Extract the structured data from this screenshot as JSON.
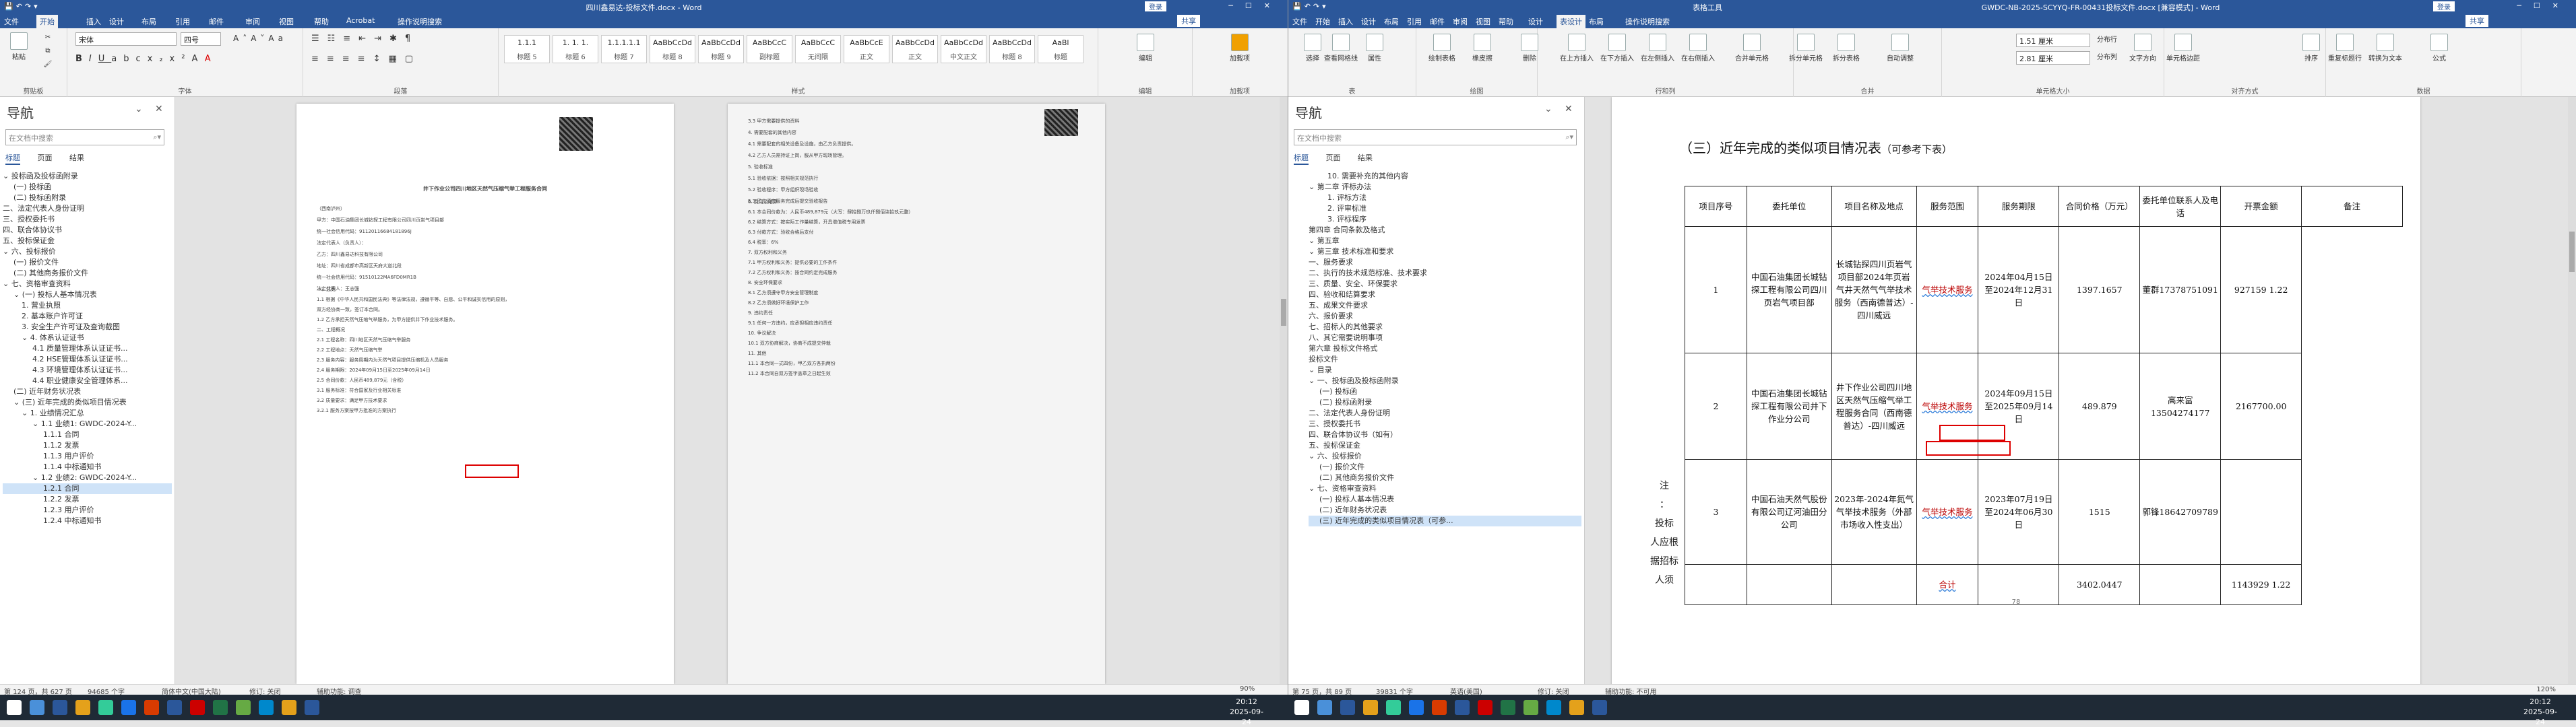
{
  "left_window": {
    "title": "四川鑫易达-投标文件.docx - Word",
    "user_label": "登录",
    "tabs": [
      "文件",
      "开始",
      "插入",
      "设计",
      "布局",
      "引用",
      "邮件",
      "审阅",
      "视图",
      "帮助",
      "Acrobat",
      "操作说明搜索"
    ],
    "share_label": "共享",
    "ribbon": {
      "clipboard": {
        "group": "剪贴板",
        "paste": "粘贴"
      },
      "font": {
        "group": "字体",
        "font_name": "宋体",
        "font_size": "四号"
      },
      "paragraph": {
        "group": "段落"
      },
      "styles": {
        "group": "样式",
        "items": [
          {
            "preview": "1.1.1",
            "name": "标题 5"
          },
          {
            "preview": "1. 1. 1.",
            "name": "标题 6"
          },
          {
            "preview": "1.1.1.1.1",
            "name": "标题 7"
          },
          {
            "preview": "AaBbCcDd",
            "name": "标题 8"
          },
          {
            "preview": "AaBbCcDd",
            "name": "标题 9"
          },
          {
            "preview": "AaBbCcC",
            "name": "副标题"
          },
          {
            "preview": "AaBbCcC",
            "name": "无间隔"
          },
          {
            "preview": "AaBbCcE",
            "name": "正文"
          },
          {
            "preview": "AaBbCcDd",
            "name": "正文"
          },
          {
            "preview": "AaBbCcDd",
            "name": "中文正文"
          },
          {
            "preview": "AaBbCcDd",
            "name": "标题 8"
          },
          {
            "preview": "AaBl",
            "name": "标题"
          }
        ]
      },
      "editing": {
        "group": "编辑",
        "label": "编辑"
      },
      "addins": {
        "group": "加载项",
        "label": "加载项"
      }
    },
    "nav": {
      "title": "导航",
      "search_placeholder": "在文档中搜索",
      "tabs": [
        "标题",
        "页面",
        "结果"
      ],
      "items": [
        "⌄ 投标函及投标函附录",
        "(一) 投标函",
        "(二) 投标函附录",
        "二、法定代表人身份证明",
        "三、授权委托书",
        "四、联合体协议书",
        "五、投标保证金",
        "⌄ 六、投标报价",
        "(一) 报价文件",
        "(二) 其他商务报价文件",
        "⌄ 七、资格审查资料",
        "⌄ (一) 投标人基本情况表",
        "1. 营业执照",
        "2. 基本账户许可证",
        "3. 安全生产许可证及查询截图",
        "⌄ 4. 体系认证证书",
        "4.1 质量管理体系认证证书...",
        "4.2 HSE管理体系认证证书...",
        "4.3 环境管理体系认证证书...",
        "4.4 职业健康安全管理体系...",
        "(二) 近年财务状况表",
        "⌄ (三) 近年完成的类似项目情况表",
        "⌄ 1. 业绩情况汇总",
        "⌄ 1.1 业绩1: GWDC-2024-Y...",
        "1.1.1 合同",
        "1.1.2 发票",
        "1.1.3 用户评价",
        "1.1.4 中标通知书",
        "⌄ 1.2 业绩2: GWDC-2024-Y...",
        "1.2.1 合同",
        "1.2.2 发票",
        "1.2.3 用户评价",
        "1.2.4 中标通知书"
      ]
    },
    "page1": {
      "title": "井下作业公司四川地区天然气压缩气举工程服务合同",
      "lines": [
        "（西南泸州）",
        "甲方：中国石油集团长城钻探工程有限公司四川页岩气项目部",
        "统一社会信用代码：91120116684181896J",
        "法定代表人（负责人）：",
        "乙方：四川鑫易达科技有限公司",
        "地址：四川省成都市高新区天府大道北段",
        "统一社会信用代码：91510122MA6FD0MR1B",
        "法定代表人：王志强",
        "一、总则",
        "1.1 根据《中华人民共和国民法典》等法律法规，遵循平等、自愿、公平和诚实信用的原则，",
        "双方经协商一致，签订本合同。",
        "1.2 乙方承担天然气压缩气举服务，为甲方提供井下作业技术服务。",
        "二、工程概况",
        "2.1 工程名称：四川地区天然气压缩气举服务",
        "2.2 工程地点：天然气压缩气举",
        "2.3 服务内容：服务周期内为天然气项目提供压缩机及人员服务",
        "2.4 服务期限：2024年09月15日至2025年09月14日",
        "2.5 合同价款：人民币489,879元（含税）",
        "3.1 服务标准：符合国家及行业相关标准",
        "3.2 质量要求：满足甲方技术要求",
        "3.2.1 服务方案按甲方批准的方案执行"
      ],
      "page_number": "124"
    },
    "page2": {
      "lines": [
        "3.3 甲方需要提供的资料",
        "4. 需要配套的其他内容",
        "4.1 需要配套的相关设备及设施，由乙方负责提供。",
        "4.2 乙方人员需持证上岗，服从甲方现场管理。",
        "5. 验收标准",
        "5.1 验收依据：按照相关规范执行",
        "5.2 验收程序：甲方组织现场验收",
        "5.3 乙方须在服务完成后提交验收报告",
        "6. 费用及结算",
        "6.1 本合同价款为：人民币489,879元（大写：肆拾捌万玖仟捌佰柒拾玖元整）",
        "6.2 结算方式：按实际工作量结算，开具增值税专用发票",
        "6.3 付款方式：验收合格后支付",
        "6.4 税率：6%",
        "7. 双方权利和义务",
        "7.1 甲方权利和义务：提供必要的工作条件",
        "7.2 乙方权利和义务：按合同约定完成服务",
        "8. 安全环保要求",
        "8.1 乙方须遵守甲方安全管理制度",
        "8.2 乙方须做好环境保护工作",
        "9. 违约责任",
        "9.1 任何一方违约，应承担相应违约责任",
        "10. 争议解决",
        "10.1 双方协商解决，协商不成提交仲裁",
        "11. 其他",
        "11.1 本合同一式四份，甲乙双方各执两份",
        "11.2 本合同自双方签字盖章之日起生效"
      ],
      "page_number": "125"
    },
    "status": {
      "page": "第 124 页，共 627 页",
      "words": "94685 个字",
      "lang": "简体中文(中国大陆)",
      "mark": "修订: 关闭",
      "access": "辅助功能: 调查"
    }
  },
  "right_window": {
    "title": "GWDC-NB-2025-SCYYQ-FR-00431投标文件.docx [兼容模式] - Word",
    "context_label": "表格工具",
    "user_label": "登录",
    "tabs": [
      "文件",
      "开始",
      "插入",
      "设计",
      "布局",
      "引用",
      "邮件",
      "审阅",
      "视图",
      "帮助",
      "设计",
      "表设计",
      "布局",
      "操作说明搜索"
    ],
    "share_label": "共享",
    "ribbon": {
      "groups": [
        "表",
        "绘图",
        "行和列",
        "合并",
        "单元格大小",
        "对齐方式",
        "数据"
      ],
      "height_value": "1.51 厘米",
      "width_value": "2.81 厘米",
      "buttons": [
        "选择",
        "查看网格线",
        "属性",
        "绘制表格",
        "橡皮擦",
        "删除",
        "在上方插入",
        "在下方插入",
        "在左侧插入",
        "在右侧插入",
        "合并单元格",
        "拆分单元格",
        "拆分表格",
        "自动调整",
        "分布行",
        "分布列",
        "文字方向",
        "单元格边距",
        "排序",
        "重复标题行",
        "转换为文本",
        "公式"
      ]
    },
    "nav": {
      "title": "导航",
      "search_placeholder": "在文档中搜索",
      "tabs": [
        "标题",
        "页面",
        "结果"
      ],
      "items": [
        "10. 需要补充的其他内容",
        "⌄ 第二章 评标办法",
        "1. 评标方法",
        "2. 评审标准",
        "3. 评标程序",
        "第四章 合同条款及格式",
        "⌄ 第五章",
        "⌄ 第三章 技术标准和要求",
        "一、服务要求",
        "二、执行的技术规范标准、技术要求",
        "三、质量、安全、环保要求",
        "四、验收和结算要求",
        "五、成果文件要求",
        "六、报价要求",
        "七、招标人的其他要求",
        "八、其它需要说明事项",
        "第六章 投标文件格式",
        "投标文件",
        "⌄ 目录",
        "⌄ 一、投标函及投标函附录",
        "(一) 投标函",
        "(二) 投标函附录",
        "二、法定代表人身份证明",
        "三、授权委托书",
        "四、联合体协议书（如有）",
        "五、投标保证金",
        "⌄ 六、投标报价",
        "(一) 报价文件",
        "(二) 其他商务报价文件",
        "⌄ 七、资格审查资料",
        "(一) 投标人基本情况表",
        "(二) 近年财务状况表",
        "(三) 近年完成的类似项目情况表（可参..."
      ]
    },
    "doc": {
      "heading": "（三）近年完成的类似项目情况表",
      "heading_note": "（可参考下表）",
      "side_note": [
        "注",
        "：",
        "投标",
        "人应根",
        "据招标",
        "人须"
      ],
      "table": {
        "headers": [
          "项目序号",
          "委托单位",
          "项目名称及地点",
          "服务范围",
          "服务期限",
          "合同价格（万元）",
          "委托单位联系人及电话",
          "开票金额",
          "备注"
        ],
        "rows": [
          [
            "1",
            "中国石油集团长城钻探工程有限公司四川页岩气项目部",
            "长城钻探四川页岩气项目部2024年页岩气井天然气气举技术服务（西南德普达）-四川威远",
            "气举技术服务",
            "2024年04月15日至2024年12月31日",
            "1397.1657",
            "董群17378751091",
            "927159 1.22"
          ],
          [
            "2",
            "中国石油集团长城钻探工程有限公司井下作业分公司",
            "井下作业公司四川地区天然气压缩气举工程服务合同（西南德普达）-四川威远",
            "气举技术服务",
            "2024年09月15日至2025年09月14日",
            "489.879",
            "高来富13504274177",
            "2167700.00"
          ],
          [
            "3",
            "中国石油天然气股份有限公司辽河油田分公司",
            "2023年-2024年氮气气举技术服务（外部市场收入性支出）",
            "气举技术服务",
            "2023年07月19日至2024年06月30日",
            "1515",
            "郭锋18642709789",
            ""
          ],
          [
            "",
            "",
            "",
            "合计",
            "",
            "3402.0447",
            "",
            "1143929 1.22"
          ]
        ]
      },
      "page_number": "78"
    },
    "status": {
      "page": "第 75 页，共 89 页",
      "words": "39831 个字",
      "lang": "英语(美国)",
      "mark": "修订: 关闭",
      "access": "辅助功能: 不可用",
      "zoom_left": "90%",
      "zoom_right": "120%"
    }
  },
  "taskbar": {
    "clock_left": {
      "time": "20:12",
      "date": "2025-09-24"
    },
    "clock_right": {
      "time": "20:12",
      "date": "2025-09-24"
    }
  }
}
